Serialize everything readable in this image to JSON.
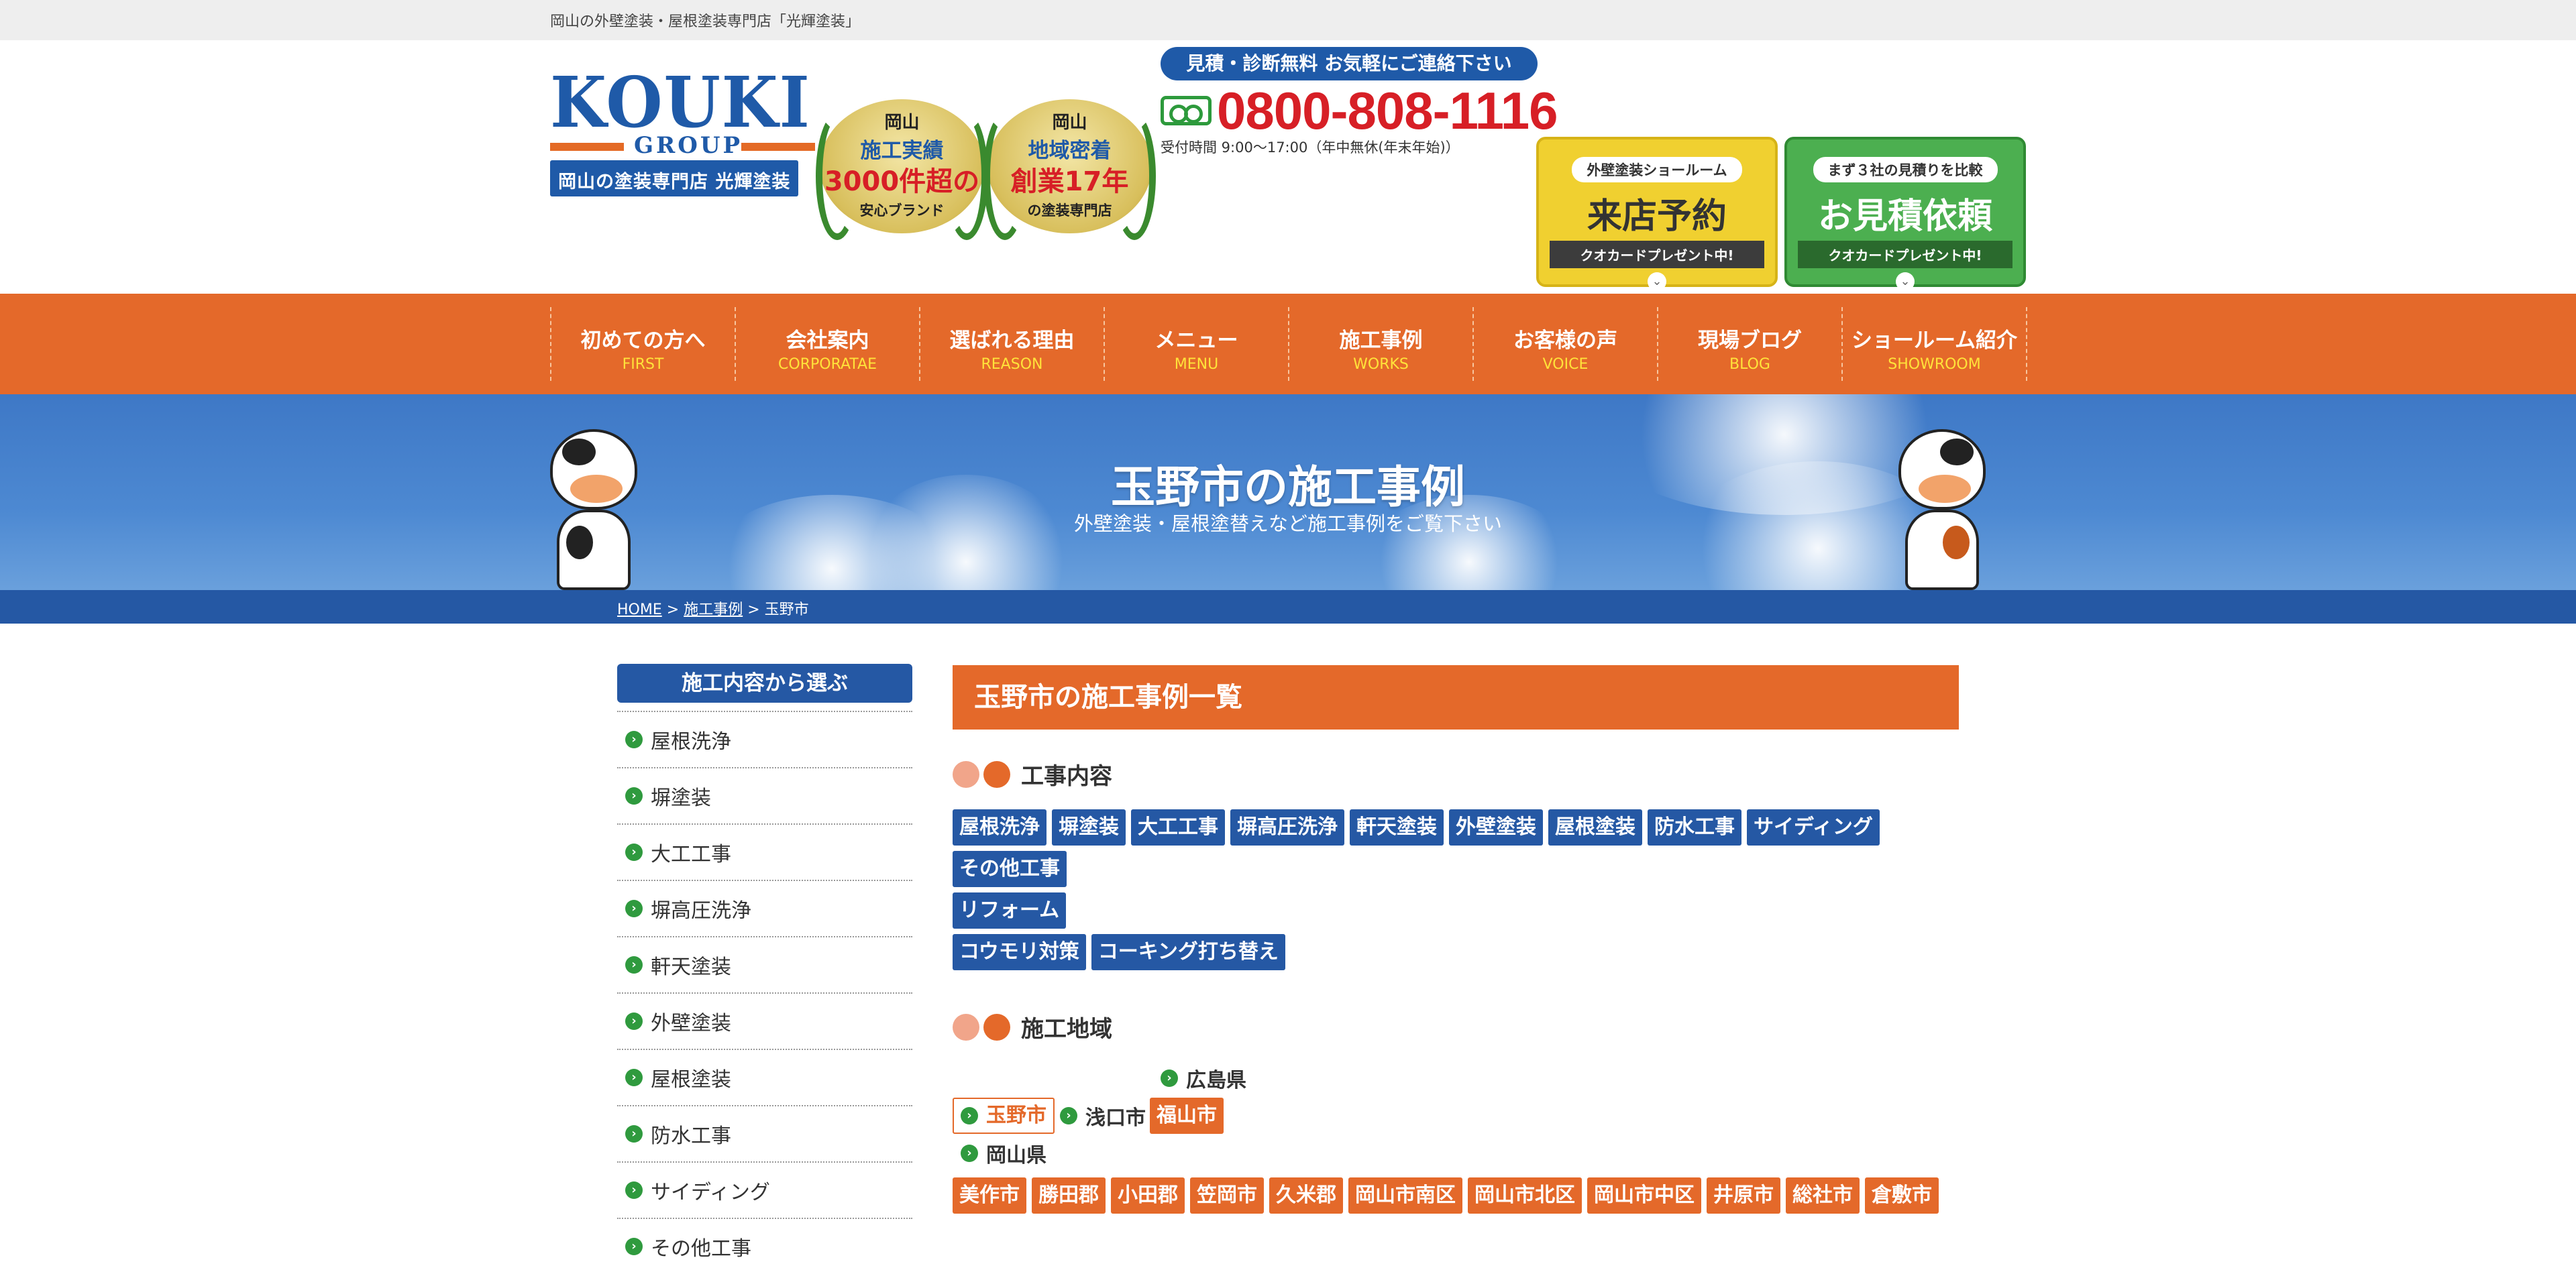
{
  "topbar": {
    "text": "岡山の外壁塗装・屋根塗装専門店「光輝塗装」"
  },
  "logo": {
    "word": "KOUKI",
    "group": "GROUP",
    "tagline": "岡山の塗装専門店 光輝塗装"
  },
  "badges": [
    {
      "line1": "岡山",
      "line2": "施工実績",
      "line3": "3000件超の",
      "line4": "安心ブランド"
    },
    {
      "line1": "岡山",
      "line2": "地域密着",
      "line3": "創業17年",
      "line4": "の塗装専門店"
    }
  ],
  "contact": {
    "pill": "見積・診断無料 お気軽にご連絡下さい",
    "phone": "0800-808-1116",
    "hours": "受付時間 9:00〜17:00（年中無休(年末年始)）"
  },
  "cta": {
    "showroom": {
      "pill": "外壁塗装ショールーム",
      "big": "来店予約",
      "ribbon": "クオカードプレゼント中!"
    },
    "estimate": {
      "pill": "まず３社の見積りを比較",
      "big": "お見積依頼",
      "ribbon": "クオカードプレゼント中!"
    }
  },
  "nav": [
    {
      "ja": "初めての方へ",
      "en": "FIRST"
    },
    {
      "ja": "会社案内",
      "en": "CORPORATAE"
    },
    {
      "ja": "選ばれる理由",
      "en": "REASON"
    },
    {
      "ja": "メニュー",
      "en": "MENU"
    },
    {
      "ja": "施工事例",
      "en": "WORKS"
    },
    {
      "ja": "お客様の声",
      "en": "VOICE"
    },
    {
      "ja": "現場ブログ",
      "en": "BLOG"
    },
    {
      "ja": "ショールーム紹介",
      "en": "SHOWROOM"
    }
  ],
  "hero": {
    "title": "玉野市の施工事例",
    "subtitle": "外壁塗装・屋根塗替えなど施工事例をご覧下さい"
  },
  "breadcrumb": {
    "home": "HOME",
    "sep": ">",
    "works": "施工事例",
    "current": "玉野市"
  },
  "sidebar": {
    "heading": "施工内容から選ぶ",
    "items": [
      "屋根洗浄",
      "塀塗装",
      "大工工事",
      "塀高圧洗浄",
      "軒天塗装",
      "外壁塗装",
      "屋根塗装",
      "防水工事",
      "サイディング",
      "その他工事"
    ]
  },
  "main": {
    "heading": "玉野市の施工事例一覧",
    "work_section": "工事内容",
    "work_tags_row1": [
      "屋根洗浄",
      "塀塗装",
      "大工工事",
      "塀高圧洗浄",
      "軒天塗装",
      "外壁塗装",
      "屋根塗装",
      "防水工事",
      "サイディング"
    ],
    "work_tags_row2": [
      "その他工事"
    ],
    "work_tags_row3": [
      "リフォーム"
    ],
    "work_tags_row4": [
      "コウモリ対策",
      "コーキング打ち替え"
    ],
    "area_section": "施工地域",
    "hiroshima": "広島県",
    "tamano": "玉野市",
    "asakuchi": "浅口市",
    "fukuyama": "福山市",
    "okayama": "岡山県",
    "okayama_cities": [
      "美作市",
      "勝田郡",
      "小田郡",
      "笠岡市",
      "久米郡",
      "岡山市南区",
      "岡山市北区",
      "岡山市中区",
      "井原市",
      "総社市",
      "倉敷市"
    ]
  }
}
